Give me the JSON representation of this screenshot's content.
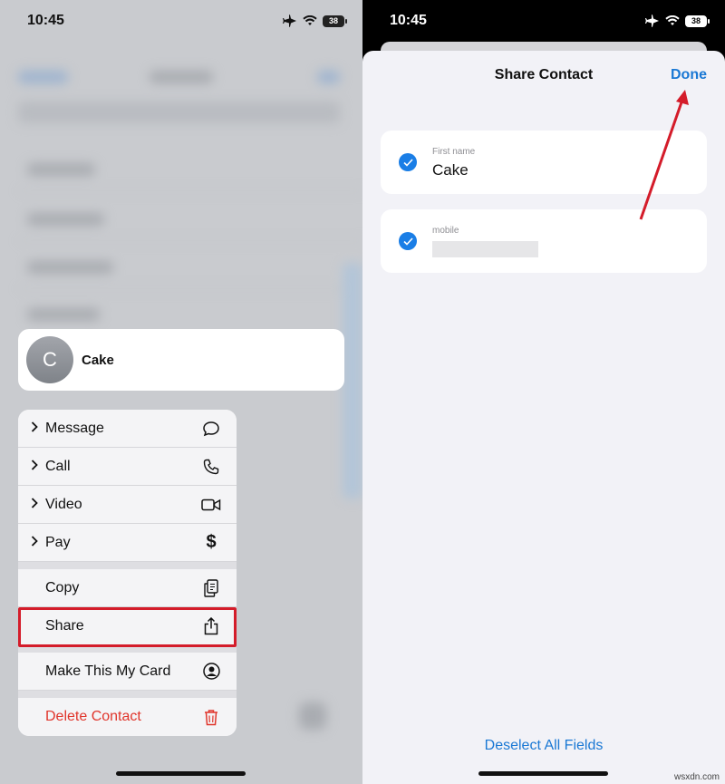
{
  "left": {
    "status": {
      "time": "10:45",
      "battery": "38"
    },
    "contact": {
      "initial": "C",
      "name": "Cake"
    },
    "menu": {
      "group1": [
        {
          "label": "Message",
          "icon": "message-icon"
        },
        {
          "label": "Call",
          "icon": "phone-icon"
        },
        {
          "label": "Video",
          "icon": "video-icon"
        },
        {
          "label": "Pay",
          "icon": "dollar-icon"
        }
      ],
      "group2": [
        {
          "label": "Copy",
          "icon": "copy-icon"
        },
        {
          "label": "Share",
          "icon": "share-icon"
        }
      ],
      "group3": [
        {
          "label": "Make This My Card",
          "icon": "person-circle-icon"
        }
      ],
      "group4": [
        {
          "label": "Delete Contact",
          "icon": "trash-icon"
        }
      ]
    }
  },
  "right": {
    "status": {
      "time": "10:45",
      "battery": "38"
    },
    "title": "Share Contact",
    "done": "Done",
    "fields": [
      {
        "label": "First name",
        "value": "Cake",
        "checked": true
      },
      {
        "label": "mobile",
        "value": "",
        "checked": true
      }
    ],
    "deselect": "Deselect All Fields"
  },
  "colors": {
    "accent": "#1a78d4",
    "destructive": "#e0352b",
    "highlight": "#d41c2a"
  },
  "watermark": "wsxdn.com"
}
